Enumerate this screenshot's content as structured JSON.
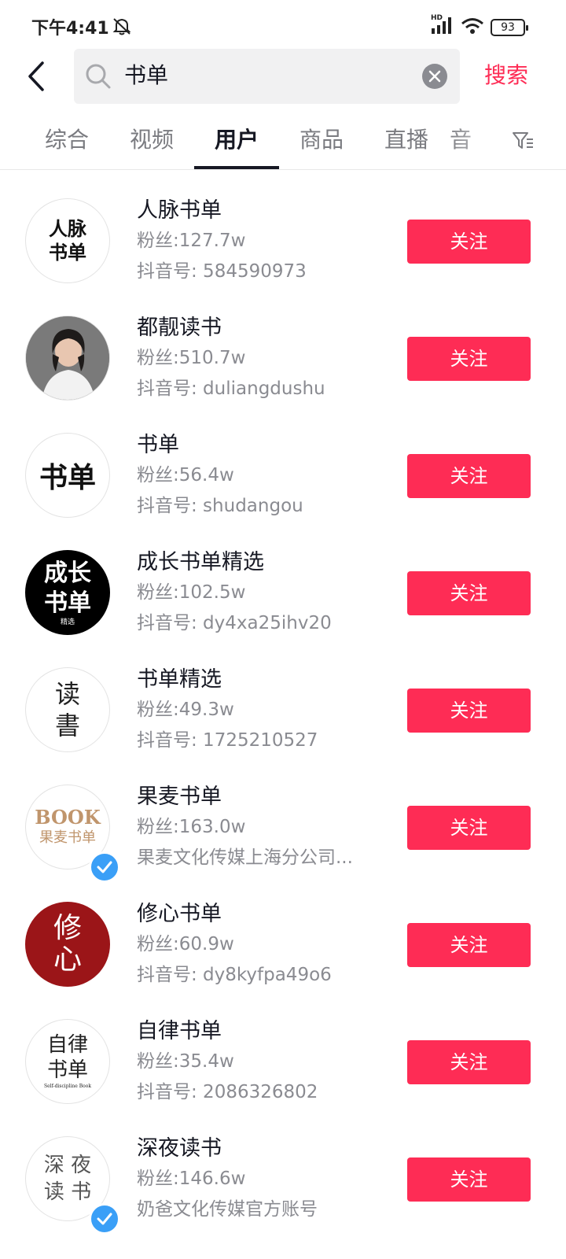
{
  "status_bar": {
    "time": "下午4:41",
    "network": "HD",
    "battery": "93",
    "icons": [
      "mute-icon",
      "signal-icon",
      "wifi-icon",
      "battery-icon"
    ]
  },
  "header": {
    "search_value": "书单",
    "search_button_label": "搜索"
  },
  "tabs": [
    {
      "label": "综合",
      "active": false
    },
    {
      "label": "视频",
      "active": false
    },
    {
      "label": "用户",
      "active": true
    },
    {
      "label": "商品",
      "active": false
    },
    {
      "label": "直播",
      "active": false
    },
    {
      "label": "音",
      "active": false
    }
  ],
  "users": [
    {
      "name": "人脉书单",
      "fans": "粉丝:127.7w",
      "id_line": "抖音号: 584590973",
      "follow_label": "关注",
      "verified": false,
      "avatar_lines": [
        "人脉",
        "书单"
      ]
    },
    {
      "name": "都靓读书",
      "fans": "粉丝:510.7w",
      "id_line": "抖音号: duliangdushu",
      "follow_label": "关注",
      "verified": false,
      "avatar_lines": []
    },
    {
      "name": "书单",
      "fans": "粉丝:56.4w",
      "id_line": "抖音号: shudangou",
      "follow_label": "关注",
      "verified": false,
      "avatar_lines": [
        "书单"
      ]
    },
    {
      "name": "成长书单精选",
      "fans": "粉丝:102.5w",
      "id_line": "抖音号: dy4xa25ihv20",
      "follow_label": "关注",
      "verified": false,
      "avatar_lines": [
        "成长",
        "书单",
        "精选"
      ]
    },
    {
      "name": "书单精选",
      "fans": "粉丝:49.3w",
      "id_line": "抖音号: 1725210527",
      "follow_label": "关注",
      "verified": false,
      "avatar_lines": [
        "读",
        "書"
      ]
    },
    {
      "name": "果麦书单",
      "fans": "粉丝:163.0w",
      "id_line": "果麦文化传媒上海分公司...",
      "follow_label": "关注",
      "verified": true,
      "avatar_lines": [
        "BOOK",
        "果麦书单"
      ]
    },
    {
      "name": "修心书单",
      "fans": "粉丝:60.9w",
      "id_line": "抖音号: dy8kyfpa49o6",
      "follow_label": "关注",
      "verified": false,
      "avatar_lines": [
        "修",
        "心"
      ]
    },
    {
      "name": "自律书单",
      "fans": "粉丝:35.4w",
      "id_line": "抖音号: 2086326802",
      "follow_label": "关注",
      "verified": false,
      "avatar_lines": [
        "自律",
        "书单",
        "Self-discipline Book"
      ]
    },
    {
      "name": "深夜读书",
      "fans": "粉丝:146.6w",
      "id_line": "奶爸文化传媒官方账号",
      "follow_label": "关注",
      "verified": true,
      "avatar_lines": [
        "深 夜",
        "读 书"
      ]
    }
  ],
  "colors": {
    "accent": "#fe2c55",
    "verified": "#3a9ff7",
    "secondary_text": "#8a8b91"
  }
}
